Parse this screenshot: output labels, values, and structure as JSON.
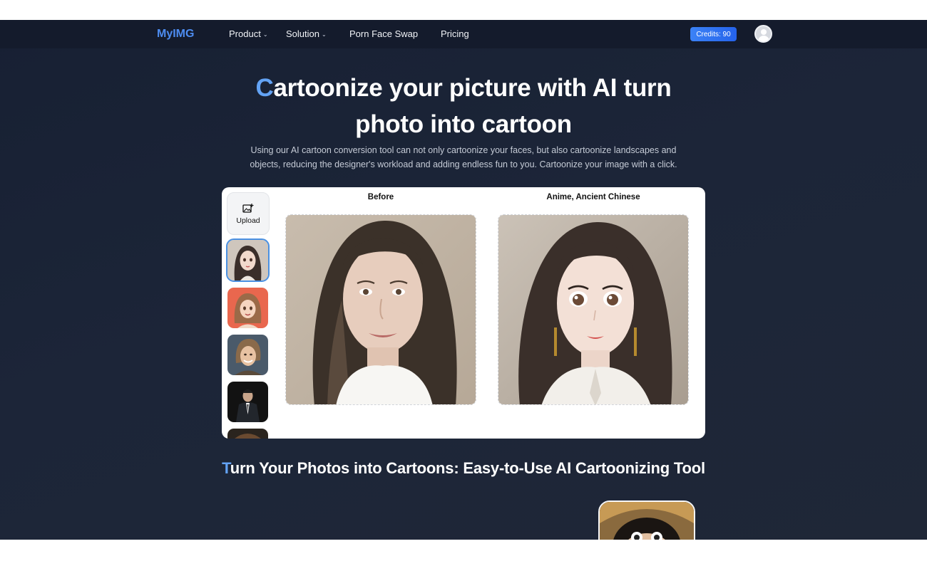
{
  "nav": {
    "logo": "MyIMG",
    "items": [
      {
        "label": "Product",
        "has_dropdown": true
      },
      {
        "label": "Solution",
        "has_dropdown": true
      },
      {
        "label": "Porn Face Swap",
        "has_dropdown": false
      },
      {
        "label": "Pricing",
        "has_dropdown": false
      }
    ],
    "credits": "Credits: 90",
    "avatar_icon": "user-avatar-icon"
  },
  "hero": {
    "title_first_letter": "C",
    "title_rest": "artoonize your picture with AI turn photo into cartoon",
    "subtitle": "Using our AI cartoon conversion tool can not only cartoonize your faces, but also cartoonize landscapes and objects, reducing the designer's workload and adding endless fun to you. Cartoonize your image with a click."
  },
  "tool": {
    "upload_label": "Upload",
    "upload_icon": "image-plus-icon",
    "styles": [
      "anime-woman",
      "anime-girl-orange",
      "anime-man-smiling",
      "man-in-suit",
      "partial-thumbnail"
    ],
    "selected_style_index": 0,
    "before_label": "Before",
    "after_label": "Anime, Ancient Chinese"
  },
  "section": {
    "title_first_letter": "T",
    "title_rest": "urn Your Photos into Cartoons: Easy-to-Use AI Cartoonizing Tool"
  },
  "colors": {
    "accent": "#63a3f5",
    "logo": "#4d8cf0",
    "credits_bg": "#2f74ea",
    "background": "#1b2436"
  }
}
